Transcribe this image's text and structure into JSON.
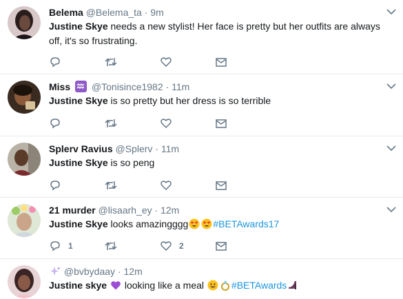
{
  "tweets": [
    {
      "name": "Belema",
      "handle": "@Belema_ta",
      "time": "9m",
      "mention": "Justine Skye",
      "text": "needs a new stylist! Her face is pretty but her outfits are always off, it's so frustrating.",
      "replies": "",
      "likes": ""
    },
    {
      "name": "Miss",
      "handle": "@Tonisince1982",
      "time": "11m",
      "mention": "Justine Skye",
      "text": "is so pretty but her dress is so terrible",
      "replies": "",
      "likes": ""
    },
    {
      "name": "Splerv Ravius",
      "handle": "@Splerv",
      "time": "11m",
      "mention": "Justine Skye",
      "text": "is so peng",
      "replies": "",
      "likes": ""
    },
    {
      "name": "21 murder",
      "handle": "@lisaarh_ey",
      "time": "12m",
      "mention": "Justine Skye",
      "text": "looks amazingggg",
      "hashtag": "#BETAwards17",
      "replies": "1",
      "likes": "2"
    },
    {
      "name": "",
      "handle": "@bvbydaay",
      "time": "12m",
      "mention": "Justine skye",
      "text": "looking like a meal",
      "hashtag": "#BETAwards",
      "replies": "",
      "likes": ""
    }
  ],
  "separator": "·",
  "icons": {
    "reply": "reply-icon",
    "retweet": "retweet-icon",
    "like": "heart-icon",
    "dm": "envelope-icon",
    "caret": "chevron-down-icon"
  },
  "colors": {
    "text": "#14171a",
    "secondary": "#657786",
    "hashtag": "#1b95e0",
    "divider": "#e6ecf0"
  }
}
